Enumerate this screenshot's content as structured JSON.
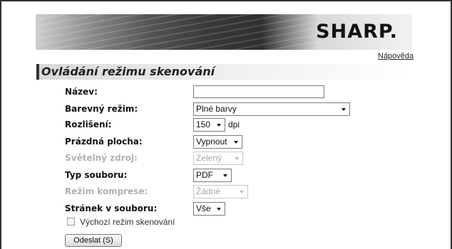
{
  "brand": {
    "logo_text": "SHARP."
  },
  "header": {
    "help_link": "Nápověda"
  },
  "section": {
    "title": "Ovládání režimu skenování"
  },
  "form": {
    "name": {
      "label": "Název:",
      "value": ""
    },
    "color_mode": {
      "label": "Barevný režim:",
      "value": "Plné barvy"
    },
    "resolution": {
      "label": "Rozlišení:",
      "value": "150",
      "unit": "dpi"
    },
    "blank_page": {
      "label": "Prázdná plocha:",
      "value": "Vypnout"
    },
    "light_source": {
      "label": "Světelný zdroj:",
      "value": "Zelený",
      "disabled": true
    },
    "file_type": {
      "label": "Typ souboru:",
      "value": "PDF"
    },
    "compression": {
      "label": "Režim komprese:",
      "value": "Žádné",
      "disabled": true
    },
    "pages_per_file": {
      "label": "Stránek v souboru:",
      "value": "Vše"
    },
    "default_mode": {
      "label": "Výchozí režim skenování",
      "checked": false
    },
    "submit_label": "Odeslat (S)"
  },
  "icons": {
    "dropdown": "chevron-down-icon"
  }
}
